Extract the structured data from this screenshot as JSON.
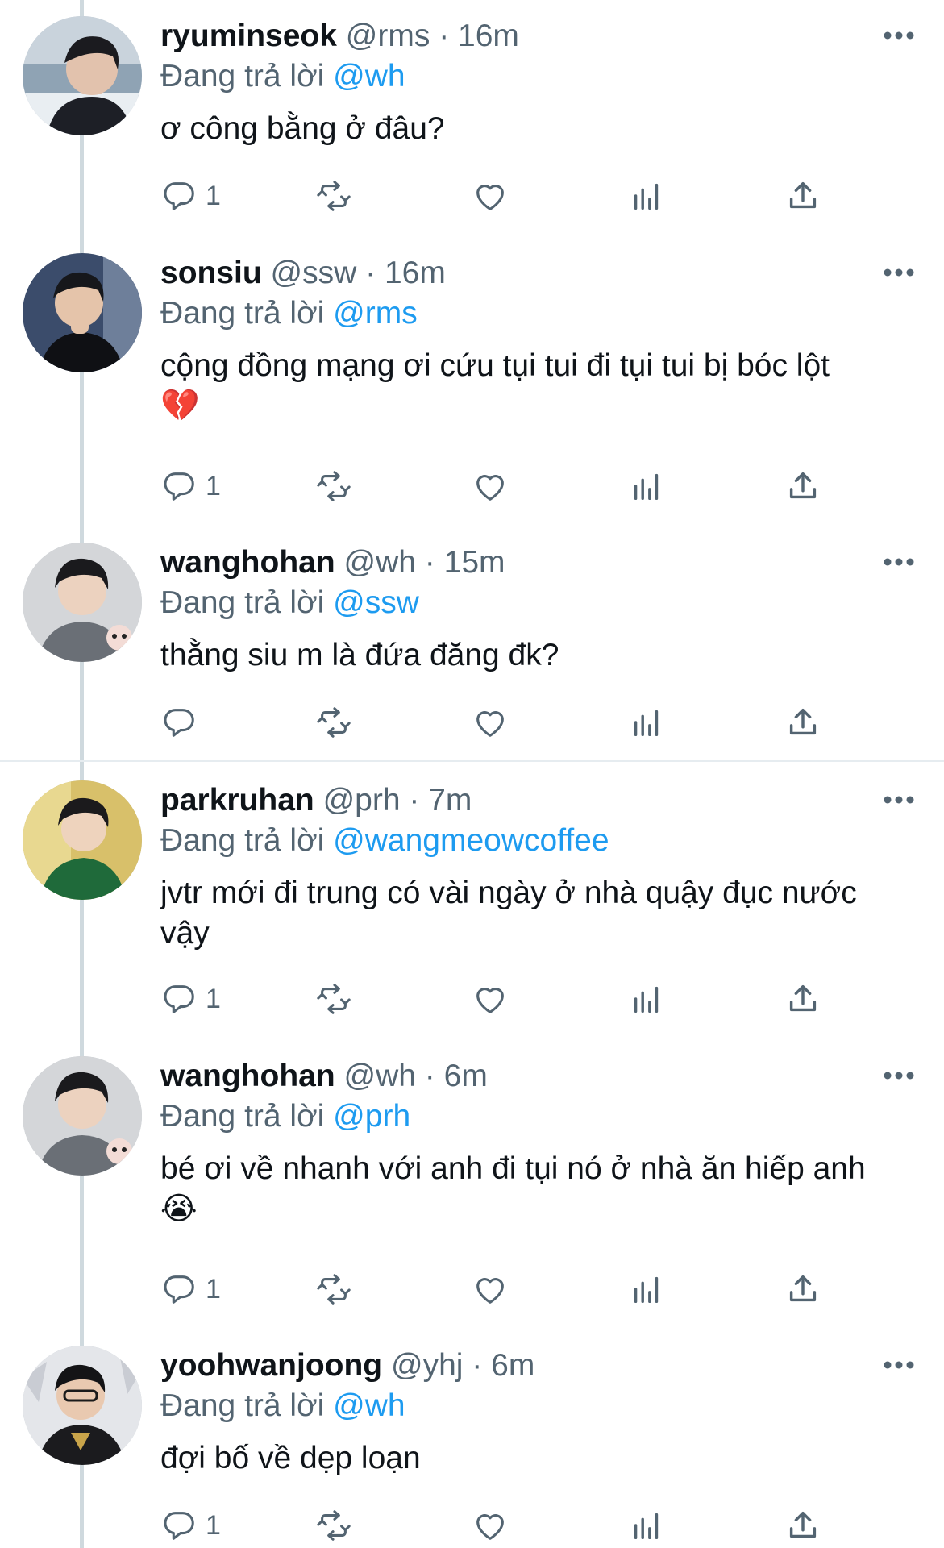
{
  "replying_prefix": "Đang trả lời",
  "tweets": [
    {
      "name": "ryuminseok",
      "handle": "@rms",
      "time": "16m",
      "sep": "·",
      "reply_to": "@wh",
      "text": "ơ công bằng ở đâu?",
      "emoji": "",
      "reply_count": "1"
    },
    {
      "name": "sonsiu",
      "handle": "@ssw",
      "time": "16m",
      "sep": "·",
      "reply_to": "@rms",
      "text": "cộng đồng mạng ơi cứu tụi tui đi tụi tui bị bóc lột",
      "emoji": "💔",
      "reply_count": "1"
    },
    {
      "name": "wanghohan",
      "handle": "@wh",
      "time": "15m",
      "sep": "·",
      "reply_to": "@ssw",
      "text": "thằng siu m là đứa đăng đk?",
      "emoji": "",
      "reply_count": ""
    },
    {
      "name": "parkruhan",
      "handle": "@prh",
      "time": "7m",
      "sep": "·",
      "reply_to": "@wangmeowcoffee",
      "text": "jvtr mới đi trung có vài ngày ở nhà quậy đục nước vậy",
      "emoji": "",
      "reply_count": "1"
    },
    {
      "name": "wanghohan",
      "handle": "@wh",
      "time": "6m",
      "sep": "·",
      "reply_to": "@prh",
      "text": "bé ơi về nhanh với anh đi tụi nó ở nhà ăn hiếp anh",
      "emoji": "😭",
      "reply_count": "1"
    },
    {
      "name": "yoohwanjoong",
      "handle": "@yhj",
      "time": "6m",
      "sep": "·",
      "reply_to": "@wh",
      "text": "đợi bố về dẹp loạn",
      "emoji": "",
      "reply_count": "1"
    }
  ],
  "icons": {
    "reply": "reply-icon",
    "retweet": "retweet-icon",
    "like": "heart-icon",
    "views": "views-icon",
    "share": "share-icon",
    "more": "more-icon"
  },
  "colors": {
    "mention": "#1d9bf0",
    "secondary_text": "#536471",
    "primary_text": "#0f1419",
    "thread_line": "#cfd9de"
  }
}
